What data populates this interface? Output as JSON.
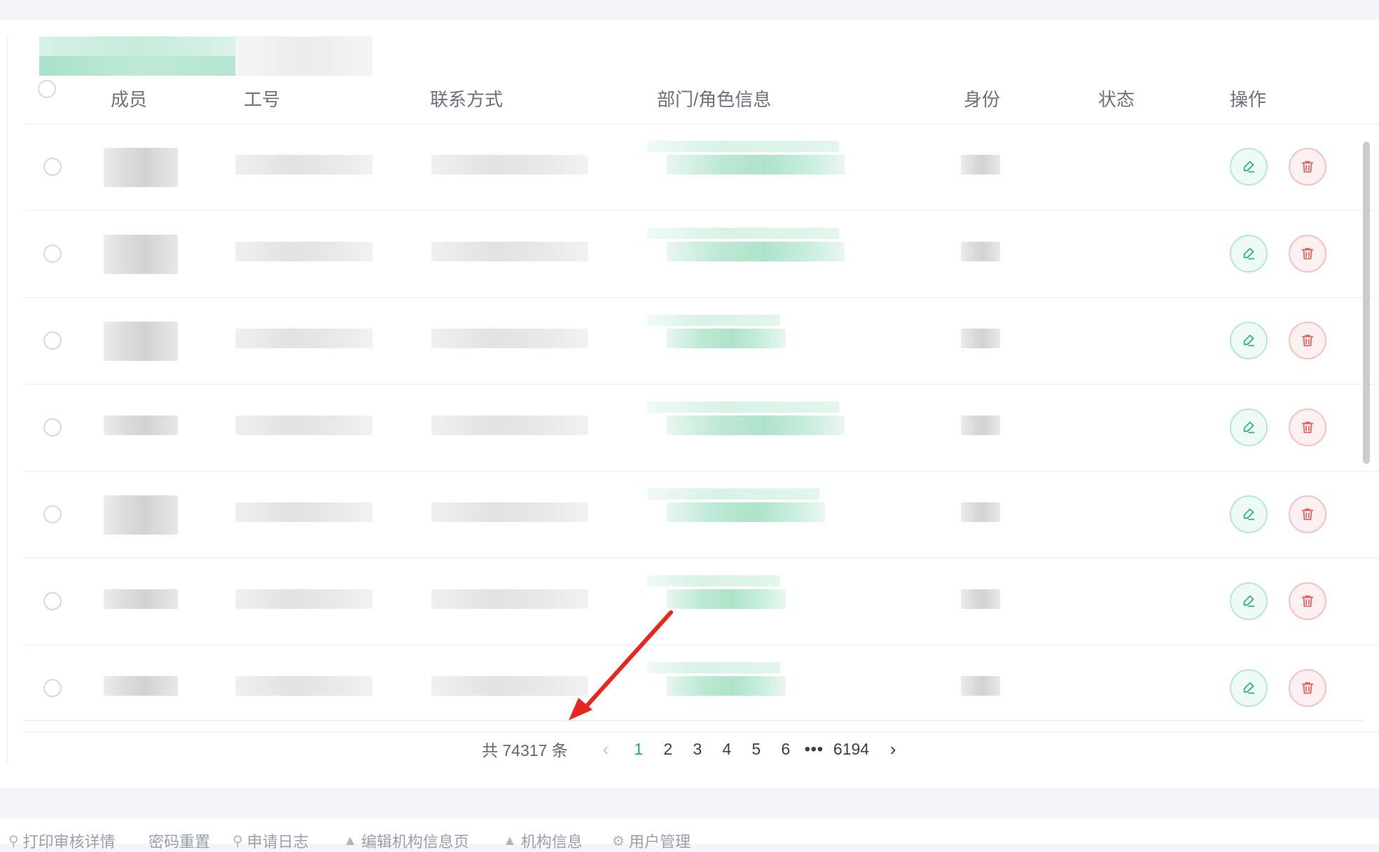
{
  "table": {
    "columns": {
      "member": "成员",
      "employee_id": "工号",
      "contact": "联系方式",
      "dept_role": "部门/角色信息",
      "identity": "身份",
      "status": "状态",
      "actions": "操作"
    },
    "visible_rows": 7
  },
  "pagination": {
    "total_label": "共 74317 条",
    "pages": [
      "1",
      "2",
      "3",
      "4",
      "5",
      "6"
    ],
    "current_page": "1",
    "ellipsis": "•••",
    "last_page": "6194",
    "prev_symbol": "‹",
    "next_symbol": "›"
  },
  "footer": {
    "items": [
      {
        "label": "打印审核详情",
        "icon": "user-key-icon"
      },
      {
        "label": "密码重置",
        "icon": ""
      },
      {
        "label": "申请日志",
        "icon": "user-key-icon"
      },
      {
        "label": "编辑机构信息页",
        "icon": "graduation-cap-icon"
      },
      {
        "label": "机构信息",
        "icon": "graduation-cap-icon"
      },
      {
        "label": "用户管理",
        "icon": "gear-icon"
      }
    ]
  },
  "colors": {
    "accent_green": "#1fae7a",
    "delete_red": "#e85a5a",
    "annotation_arrow": "#e8261f"
  }
}
